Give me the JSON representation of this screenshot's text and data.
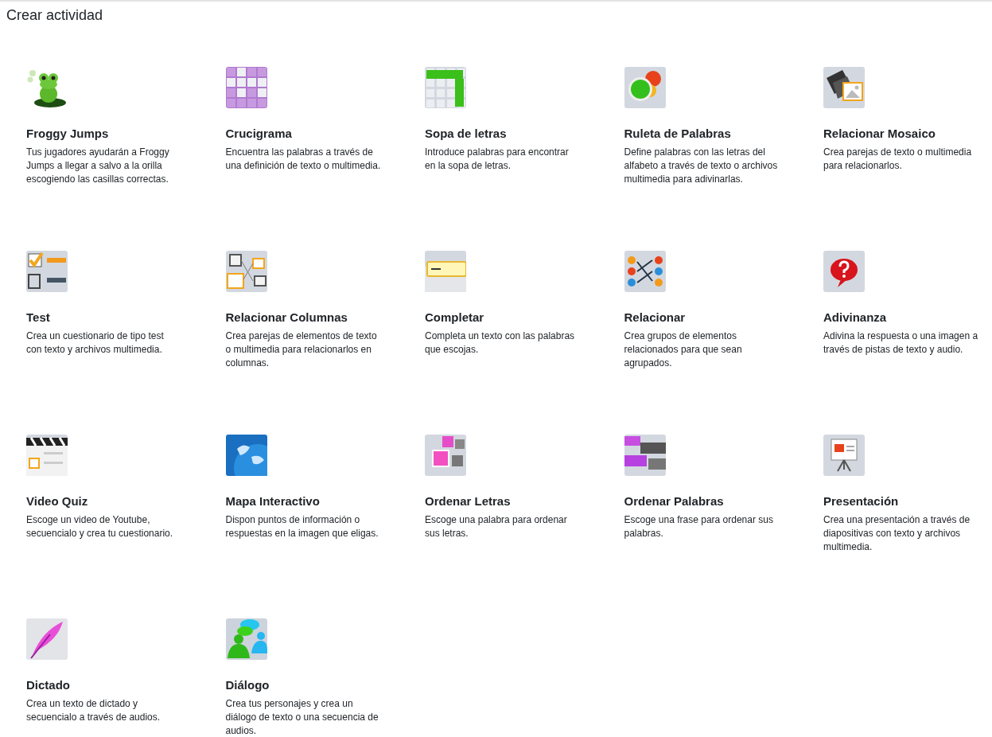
{
  "page": {
    "title": "Crear actividad"
  },
  "activities": [
    {
      "kind": "frog",
      "title": "Froggy Jumps",
      "description": "Tus jugadores ayudarán a Froggy Jumps a llegar a salvo a la orilla escogiendo las casillas correctas."
    },
    {
      "kind": "crossword",
      "title": "Crucigrama",
      "description": "Encuentra las palabras a través de una definición de texto o multimedia."
    },
    {
      "kind": "wordsearch",
      "title": "Sopa de letras",
      "description": "Introduce palabras para encontrar en la sopa de letras."
    },
    {
      "kind": "wheel",
      "title": "Ruleta de Palabras",
      "description": "Define palabras con las letras del alfabeto a través de texto o archivos multimedia para adivinarlas."
    },
    {
      "kind": "mosaic",
      "title": "Relacionar Mosaico",
      "description": "Crea parejas de texto o multimedia para relacionarlos."
    },
    {
      "kind": "test",
      "title": "Test",
      "description": "Crea un cuestionario de tipo test con texto y archivos multimedia."
    },
    {
      "kind": "columns",
      "title": "Relacionar Columnas",
      "description": "Crea parejas de elementos de texto o multimedia para relacionarlos en columnas."
    },
    {
      "kind": "fill",
      "title": "Completar",
      "description": "Completa un texto con las palabras que escojas."
    },
    {
      "kind": "match",
      "title": "Relacionar",
      "description": "Crea grupos de elementos relacionados para que sean agrupados."
    },
    {
      "kind": "riddle",
      "title": "Adivinanza",
      "description": "Adivina la respuesta o una imagen a través de pistas de texto y audio."
    },
    {
      "kind": "video",
      "title": "Video Quiz",
      "description": "Escoge un video de Youtube, secuencialo y crea tu cuestionario."
    },
    {
      "kind": "map",
      "title": "Mapa Interactivo",
      "description": "Dispon puntos de información o respuestas en la imagen que eligas."
    },
    {
      "kind": "letters",
      "title": "Ordenar Letras",
      "description": "Escoge una palabra para ordenar sus letras."
    },
    {
      "kind": "words",
      "title": "Ordenar Palabras",
      "description": "Escoge una frase para ordenar sus palabras."
    },
    {
      "kind": "slides",
      "title": "Presentación",
      "description": "Crea una presentación a través de diapositivas con texto y archivos multimedia."
    },
    {
      "kind": "dictation",
      "title": "Dictado",
      "description": "Crea un texto de dictado y secuencialo a través de audios."
    },
    {
      "kind": "dialog",
      "title": "Diálogo",
      "description": "Crea tus personajes y crea un diálogo de texto o una secuencia de audios."
    }
  ]
}
